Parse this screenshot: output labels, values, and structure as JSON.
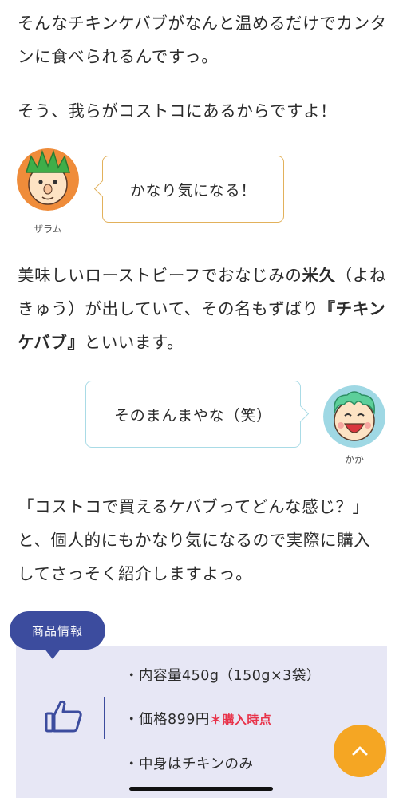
{
  "paragraphs": {
    "p1": "そんなチキンケバブがなんと温めるだけでカンタンに食べられるんですっ。",
    "p2": "そう、我らがコストコにあるからですよ！",
    "p3_a": "美味しいローストビーフでおなじみの",
    "p3_b": "米久",
    "p3_c": "（よねきゅう）が出していて、その名もずばり",
    "p3_d": "『チキンケバブ』",
    "p3_e": "といいます。",
    "p4": "「コストコで買えるケバブってどんな感じ？」と、個人的にもかなり気になるので実際に購入してさっそく紹介しますよっ。"
  },
  "chat": {
    "zaramu": {
      "name": "ザラム",
      "text": "かなり気になる！",
      "border_color": "#e2b15b"
    },
    "kaka": {
      "name": "かか",
      "text": "そのまんまやな（笑）",
      "border_color": "#a9dbe6"
    }
  },
  "product_info": {
    "tag": "商品情報",
    "items": [
      "・内容量450g（150g×3袋）",
      "・価格899円",
      "・中身はチキンのみ"
    ],
    "price_note": "＊購入時点",
    "accent_color": "#3c4c9e",
    "background": "#e7e7f5"
  },
  "icons": {
    "thumb": "thumbs-up-icon",
    "scroll": "chevron-up-icon"
  },
  "colors": {
    "scroll_button": "#f5a623",
    "note_red": "#e8334a"
  }
}
